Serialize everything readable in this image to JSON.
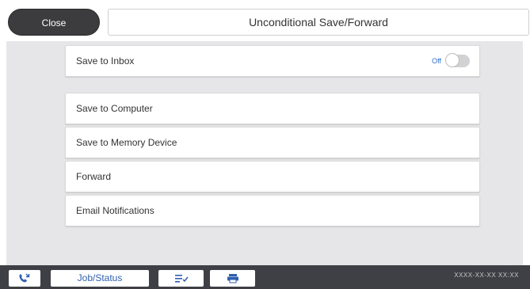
{
  "header": {
    "close_label": "Close",
    "title": "Unconditional Save/Forward"
  },
  "settings": {
    "save_to_inbox": {
      "label": "Save to Inbox",
      "state_label": "Off",
      "state": "off"
    },
    "items": [
      {
        "label": "Save to Computer"
      },
      {
        "label": "Save to Memory Device"
      },
      {
        "label": "Forward"
      },
      {
        "label": "Email Notifications"
      }
    ]
  },
  "bottombar": {
    "fax_icon": "fax-icon",
    "job_status_label": "Job/Status",
    "job_list_icon": "job-list-icon",
    "printer_icon": "printer-icon",
    "status_text": "XXXX-XX-XX XX:XX"
  },
  "colors": {
    "content_bg": "#e6e6e8",
    "close_button_bg": "#3c3c3e",
    "bottombar_bg": "#3f4045",
    "accent_text": "#2f5fae"
  }
}
